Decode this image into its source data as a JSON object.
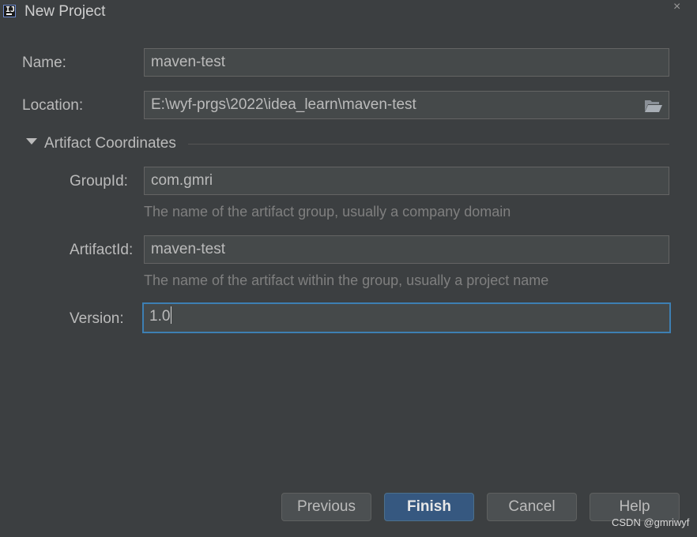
{
  "window": {
    "title": "New Project",
    "app_icon_text": "IJ",
    "close_glyph": "×"
  },
  "form": {
    "name": {
      "label": "Name:",
      "value": "maven-test"
    },
    "location": {
      "label": "Location:",
      "value": "E:\\wyf-prgs\\2022\\idea_learn\\maven-test",
      "icon": "folder-open-icon"
    },
    "artifact_section": {
      "title": "Artifact Coordinates",
      "expanded": true
    },
    "group_id": {
      "label": "GroupId:",
      "value": "com.gmri",
      "hint": "The name of the artifact group, usually a company domain"
    },
    "artifact_id": {
      "label": "ArtifactId:",
      "value": "maven-test",
      "hint": "The name of the artifact within the group, usually a project name"
    },
    "version": {
      "label": "Version:",
      "value": "1.0"
    }
  },
  "buttons": {
    "previous": "Previous",
    "finish": "Finish",
    "cancel": "Cancel",
    "help": "Help"
  },
  "watermark": "CSDN @gmriwyf",
  "colors": {
    "background": "#3c3f41",
    "field_bg": "#45494a",
    "focus_border": "#3d7fb3",
    "primary_button": "#365880"
  }
}
